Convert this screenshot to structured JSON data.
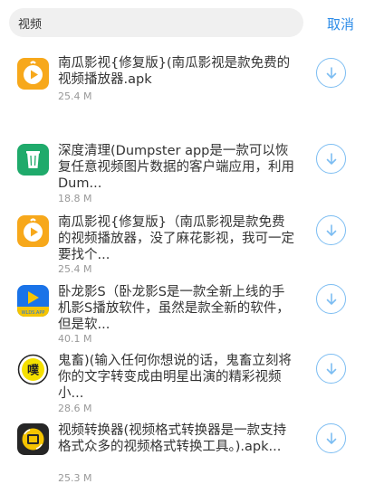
{
  "search": {
    "query": "视频"
  },
  "header": {
    "cancel_label": "取消"
  },
  "colors": {
    "accent": "#2d8ce8",
    "download_ring": "#7cbdf2",
    "size_text": "#999999"
  },
  "results": [
    {
      "title": "南瓜影视{修复版}(南瓜影视是款免费的视频播放器.apk",
      "size": "25.4 M",
      "icon": "pumpkin-video-icon"
    },
    {
      "title": "深度清理(Dumpster app是一款可以恢复任意视频图片数据的客户端应用，利用Dum...",
      "size": "18.8 M",
      "icon": "dumpster-trash-icon"
    },
    {
      "title": "南瓜影视{修复版}（南瓜影视是款免费的视频播放器，没了麻花影视，我可一定要找个...",
      "size": "25.4 M",
      "icon": "pumpkin-video-icon"
    },
    {
      "title": "卧龙影S（卧龙影S是一款全新上线的手机影S播放软件，虽然是款全新的软件，但是软...",
      "size": "40.1 M",
      "icon": "wolong-play-icon"
    },
    {
      "title": "鬼畜)(输入任何你想说的话，鬼畜立刻将你的文字转变成由明星出演的精彩视频小...",
      "size": "28.6 M",
      "icon": "guichu-pu-icon"
    },
    {
      "title": "视频转换器(视频格式转换器是一款支持格式众多的视频格式转换工具。).apk...",
      "size": "25.3 M",
      "icon": "video-converter-icon"
    }
  ]
}
